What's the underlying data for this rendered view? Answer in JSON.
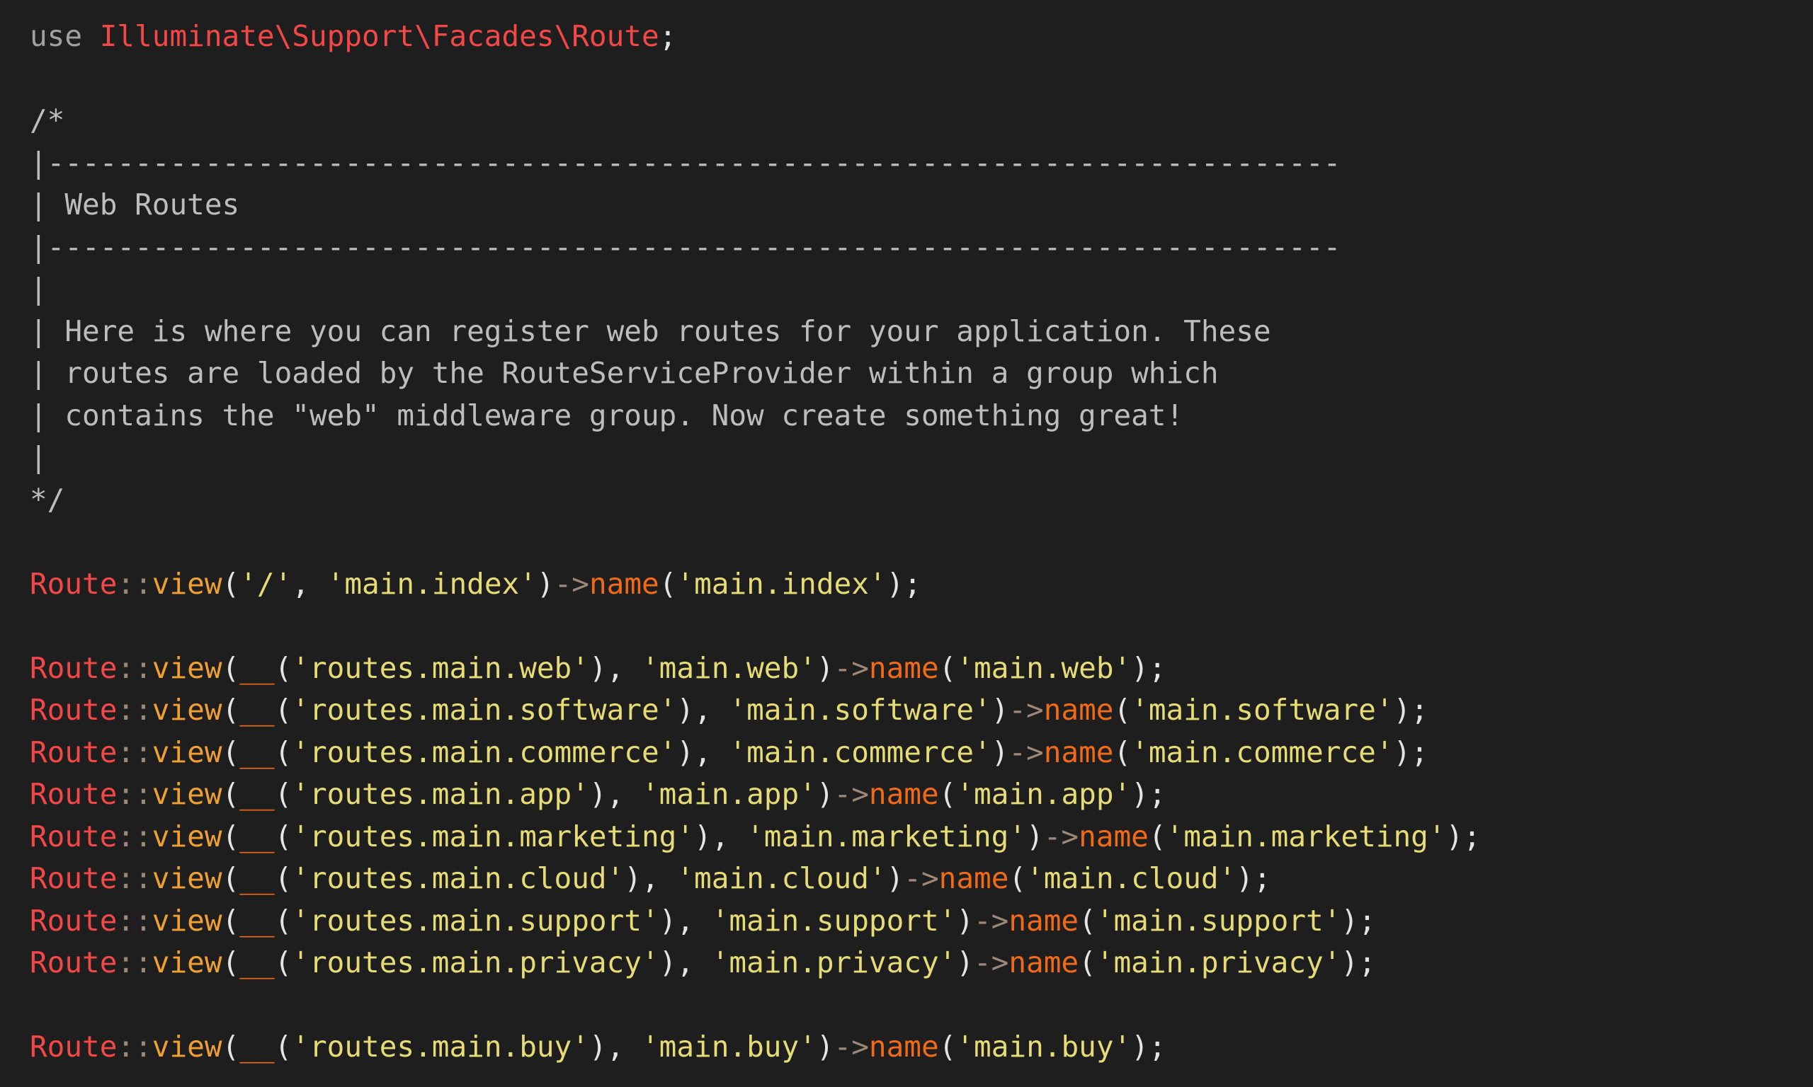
{
  "colors": {
    "background": "#1e1e1e",
    "keyword": "#a0a0a0",
    "namespace": "#f44747",
    "comment": "#bdbdbd",
    "class": "#f44747",
    "method": "#f0a030",
    "helper": "#f06a18",
    "string": "#e6db74",
    "punctuation": "#e4e4e4"
  },
  "code": {
    "use_line": {
      "keyword": "use ",
      "namespace": "Illuminate\\Support\\Facades\\Route",
      "end": ";"
    },
    "comment_lines": [
      "/*",
      "|--------------------------------------------------------------------------",
      "| Web Routes",
      "|--------------------------------------------------------------------------",
      "|",
      "| Here is where you can register web routes for your application. These",
      "| routes are loaded by the RouteServiceProvider within a group which",
      "| contains the \"web\" middleware group. Now create something great!",
      "|",
      "*/"
    ],
    "index_route": {
      "class": "Route",
      "op": "::",
      "method": "view",
      "open": "(",
      "path": "'/'",
      "sep": ", ",
      "view": "'main.index'",
      "close": ")",
      "arrow": "->",
      "chain": "name",
      "open2": "(",
      "name": "'main.index'",
      "end": ");"
    },
    "routes": [
      {
        "class": "Route",
        "op": "::",
        "method": "view",
        "open": "(",
        "helper": "__",
        "hopen": "(",
        "key": "'routes.main.web'",
        "hclose": ")",
        "sep": ", ",
        "view": "'main.web'",
        "close": ")",
        "arrow": "->",
        "chain": "name",
        "open2": "(",
        "name": "'main.web'",
        "end": ");"
      },
      {
        "class": "Route",
        "op": "::",
        "method": "view",
        "open": "(",
        "helper": "__",
        "hopen": "(",
        "key": "'routes.main.software'",
        "hclose": ")",
        "sep": ", ",
        "view": "'main.software'",
        "close": ")",
        "arrow": "->",
        "chain": "name",
        "open2": "(",
        "name": "'main.software'",
        "end": ");"
      },
      {
        "class": "Route",
        "op": "::",
        "method": "view",
        "open": "(",
        "helper": "__",
        "hopen": "(",
        "key": "'routes.main.commerce'",
        "hclose": ")",
        "sep": ", ",
        "view": "'main.commerce'",
        "close": ")",
        "arrow": "->",
        "chain": "name",
        "open2": "(",
        "name": "'main.commerce'",
        "end": ");"
      },
      {
        "class": "Route",
        "op": "::",
        "method": "view",
        "open": "(",
        "helper": "__",
        "hopen": "(",
        "key": "'routes.main.app'",
        "hclose": ")",
        "sep": ", ",
        "view": "'main.app'",
        "close": ")",
        "arrow": "->",
        "chain": "name",
        "open2": "(",
        "name": "'main.app'",
        "end": ");"
      },
      {
        "class": "Route",
        "op": "::",
        "method": "view",
        "open": "(",
        "helper": "__",
        "hopen": "(",
        "key": "'routes.main.marketing'",
        "hclose": ")",
        "sep": ", ",
        "view": "'main.marketing'",
        "close": ")",
        "arrow": "->",
        "chain": "name",
        "open2": "(",
        "name": "'main.marketing'",
        "end": ");"
      },
      {
        "class": "Route",
        "op": "::",
        "method": "view",
        "open": "(",
        "helper": "__",
        "hopen": "(",
        "key": "'routes.main.cloud'",
        "hclose": ")",
        "sep": ", ",
        "view": "'main.cloud'",
        "close": ")",
        "arrow": "->",
        "chain": "name",
        "open2": "(",
        "name": "'main.cloud'",
        "end": ");"
      },
      {
        "class": "Route",
        "op": "::",
        "method": "view",
        "open": "(",
        "helper": "__",
        "hopen": "(",
        "key": "'routes.main.support'",
        "hclose": ")",
        "sep": ", ",
        "view": "'main.support'",
        "close": ")",
        "arrow": "->",
        "chain": "name",
        "open2": "(",
        "name": "'main.support'",
        "end": ");"
      },
      {
        "class": "Route",
        "op": "::",
        "method": "view",
        "open": "(",
        "helper": "__",
        "hopen": "(",
        "key": "'routes.main.privacy'",
        "hclose": ")",
        "sep": ", ",
        "view": "'main.privacy'",
        "close": ")",
        "arrow": "->",
        "chain": "name",
        "open2": "(",
        "name": "'main.privacy'",
        "end": ");"
      }
    ],
    "buy_route": {
      "class": "Route",
      "op": "::",
      "method": "view",
      "open": "(",
      "helper": "__",
      "hopen": "(",
      "key": "'routes.main.buy'",
      "hclose": ")",
      "sep": ", ",
      "view": "'main.buy'",
      "close": ")",
      "arrow": "->",
      "chain": "name",
      "open2": "(",
      "name": "'main.buy'",
      "end": ");"
    }
  }
}
